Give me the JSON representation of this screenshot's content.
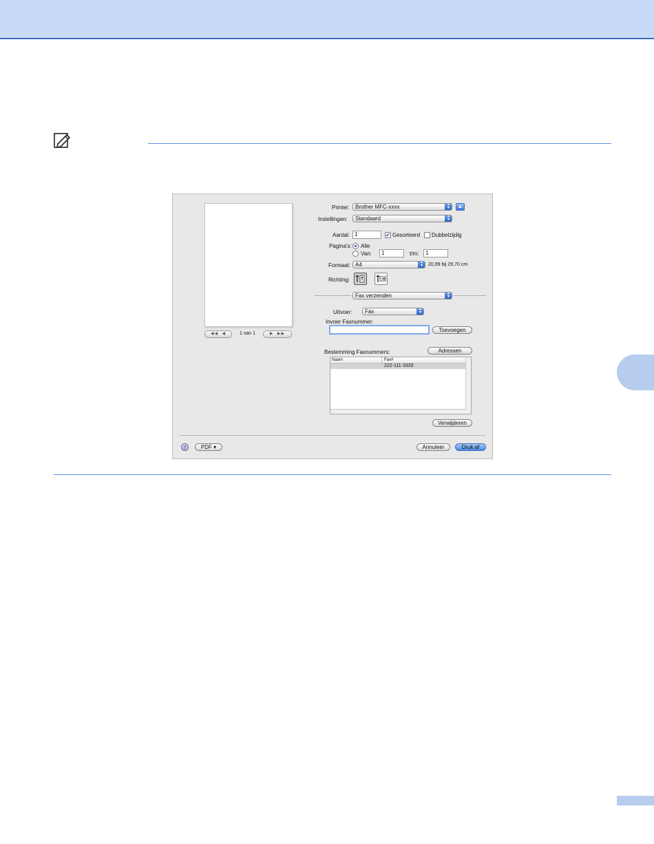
{
  "printer": {
    "label": "Printer:",
    "value": "Brother MFC-xxxx",
    "expand_icon": "disclosure-up-icon"
  },
  "settings": {
    "label": "Instellingen:",
    "value": "Standaard"
  },
  "copies": {
    "label": "Aantal:",
    "value": "1",
    "collated_label": "Gesorteerd",
    "collated_checked": true,
    "duplex_label": "Dubbelzijdig",
    "duplex_checked": false
  },
  "pages": {
    "label": "Pagina's:",
    "all_label": "Alle",
    "range_label": "Van:",
    "from_value": "1",
    "to_label": "t/m:",
    "to_value": "1",
    "selected": "Alle"
  },
  "paper_size": {
    "label": "Formaat:",
    "value": "A4",
    "dimensions": "20,99 bij 29,70 cm"
  },
  "orientation": {
    "label": "Richting:",
    "selected": "portrait",
    "icons": [
      "portrait-orientation-icon",
      "landscape-orientation-icon"
    ]
  },
  "panel": {
    "value": "Fax verzenden"
  },
  "output": {
    "label": "Uitvoer:",
    "value": "Fax"
  },
  "fax_input": {
    "label": "Invoer Faxnummer:",
    "value": "",
    "add_button": "Toevoegen"
  },
  "destination": {
    "label": "Bestemming Faxnummers:",
    "address_button": "Adressen",
    "columns": [
      "Naam",
      "Fax#"
    ],
    "rows": [
      {
        "name": "",
        "fax": "222-111-3333"
      }
    ],
    "delete_button": "Verwijderen"
  },
  "preview": {
    "page_counter": "1 van 1",
    "nav_first": "◀◀",
    "nav_prev": "◀",
    "nav_next": "▶",
    "nav_last": "▶▶"
  },
  "footer": {
    "help_glyph": "?",
    "pdf_button": "PDF ▾",
    "cancel_button": "Annuleer",
    "print_button": "Druk af"
  },
  "colors": {
    "accent": "#3a6bc4",
    "header_band": "#c9daf8",
    "tab": "#b7cdef",
    "default_button": "#4a86e0"
  },
  "icons": {
    "note": "note-pencil-icon"
  }
}
